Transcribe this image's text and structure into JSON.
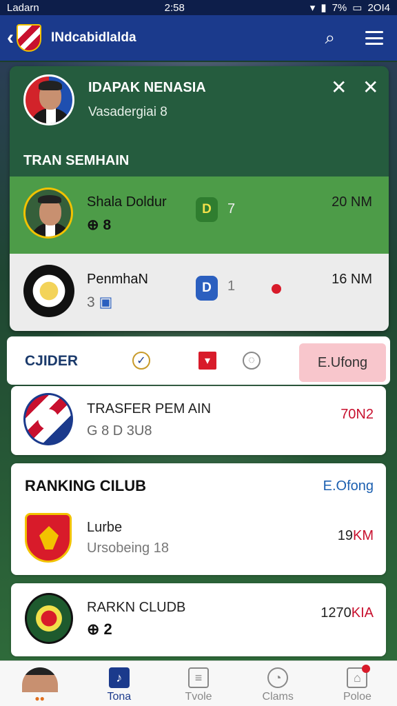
{
  "status_bar": {
    "carrier": "Ladarn",
    "time": "2:58",
    "battery": "7%",
    "right_text": "2OI4"
  },
  "header": {
    "title": "INdcabidlalda"
  },
  "profile": {
    "name": "IDAPAK NENASIA",
    "subtitle": "Vasadergiai 8",
    "section_title": "TRAN SEMHAIN"
  },
  "players": [
    {
      "name": "Shala Doldur",
      "sub": "8",
      "badge": "D",
      "badge_num": "7",
      "value": "20 NM"
    },
    {
      "name": "PenmhaN",
      "sub": "3",
      "badge": "D",
      "badge_num": "1",
      "value": "16 NM"
    }
  ],
  "filter": {
    "title": "CJIDER",
    "button": "E.Ufong"
  },
  "transfer": {
    "title": "TRASFER PEM AIN",
    "sub": "G 8 D 3U8",
    "value": "70N2"
  },
  "ranking": {
    "title": "RANKING CILUB",
    "link": "E.Ofong",
    "name": "Lurbe",
    "sub": "Ursobeing 18",
    "value_num": "19",
    "value_unit": "KM"
  },
  "ranking2": {
    "name": "RARKN CLUDB",
    "sub": "2",
    "value_num": "1270",
    "value_unit": "KIA"
  },
  "nav": [
    {
      "label": ""
    },
    {
      "label": "Tona"
    },
    {
      "label": "Tvole"
    },
    {
      "label": "Clams"
    },
    {
      "label": "Poloe"
    }
  ],
  "colors": {
    "header": "#1b3a8c",
    "card_green": "#4d9c48",
    "accent_red": "#c8102e",
    "filter_button": "#f8c6cc"
  }
}
